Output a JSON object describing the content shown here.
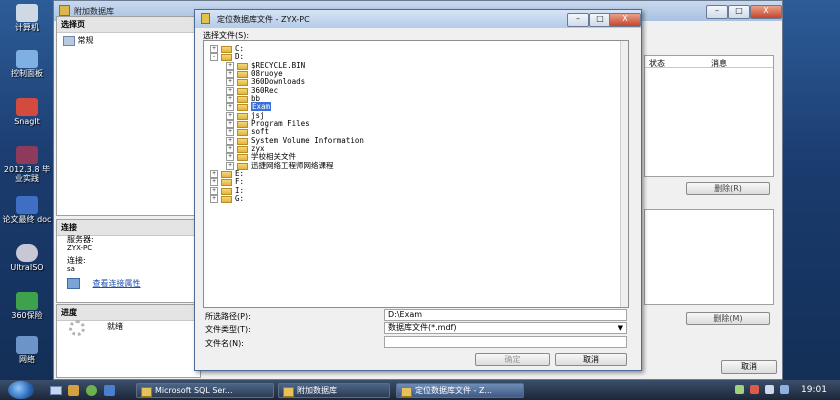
{
  "desktop": {
    "icons": [
      {
        "label": "计算机",
        "icon": "computer-icon"
      },
      {
        "label": "控制面板",
        "icon": "control-panel-icon"
      },
      {
        "label": "SnagIt",
        "icon": "snagit-icon"
      },
      {
        "label": "2012.3.8 毕业实践",
        "icon": "document-icon"
      },
      {
        "label": "论文最终 doc",
        "icon": "word-doc-icon"
      },
      {
        "label": "UltraISO",
        "icon": "ultraiso-icon"
      },
      {
        "label": "360保险",
        "icon": "360-safe-icon"
      },
      {
        "label": "网络",
        "icon": "network-icon"
      }
    ]
  },
  "attach_window": {
    "title": "附加数据库",
    "select_page_header": "选择页",
    "pages": [
      {
        "label": "常规",
        "icon": "page-icon"
      }
    ],
    "connection_header": "连接",
    "server_label": "服务器:",
    "server_value": "ZYX-PC",
    "connection_label": "连接:",
    "connection_value": "sa",
    "view_connection_link": "查看连接属性",
    "progress_header": "进度",
    "progress_status": "就绪",
    "grid_columns": [
      "状态",
      "消息"
    ],
    "remove_button_1": "删除(R)",
    "remove_button_2": "删除(M)",
    "cancel_button": "取消",
    "title_buttons": {
      "min": "–",
      "max": "□",
      "close": "X"
    }
  },
  "locate_dialog": {
    "title": "定位数据库文件 - ZYX-PC",
    "select_file_label": "选择文件(S):",
    "tree": [
      {
        "label": "C:",
        "level": 0,
        "expander": "+"
      },
      {
        "label": "D:",
        "level": 0,
        "expander": "-"
      },
      {
        "label": "$RECYCLE.BIN",
        "level": 1,
        "expander": "+"
      },
      {
        "label": "08ruoye",
        "level": 1,
        "expander": "+"
      },
      {
        "label": "360Downloads",
        "level": 1,
        "expander": "+"
      },
      {
        "label": "360Rec",
        "level": 1,
        "expander": "+"
      },
      {
        "label": "bb",
        "level": 1,
        "expander": "+"
      },
      {
        "label": "Exam",
        "level": 1,
        "expander": "+",
        "selected": true
      },
      {
        "label": "jsj",
        "level": 1,
        "expander": "+"
      },
      {
        "label": "Program Files",
        "level": 1,
        "expander": "+"
      },
      {
        "label": "soft",
        "level": 1,
        "expander": "+"
      },
      {
        "label": "System Volume Information",
        "level": 1,
        "expander": "+"
      },
      {
        "label": "zyx",
        "level": 1,
        "expander": "+"
      },
      {
        "label": "学校相关文件",
        "level": 1,
        "expander": "+"
      },
      {
        "label": "迅捷网络工程师网络课程",
        "level": 1,
        "expander": "+"
      },
      {
        "label": "E:",
        "level": 0,
        "expander": "+"
      },
      {
        "label": "F:",
        "level": 0,
        "expander": "+"
      },
      {
        "label": "I:",
        "level": 0,
        "expander": "+"
      },
      {
        "label": "G:",
        "level": 0,
        "expander": "+"
      }
    ],
    "selected_path_label": "所选路径(P):",
    "selected_path_value": "D:\\Exam",
    "file_type_label": "文件类型(T):",
    "file_type_value": "数据库文件(*.mdf)",
    "file_name_label": "文件名(N):",
    "file_name_value": "",
    "ok_button": "确定",
    "cancel_button": "取消",
    "title_buttons": {
      "min": "–",
      "max": "□",
      "close": "X"
    }
  },
  "taskbar": {
    "items": [
      {
        "label": "Microsoft SQL Ser...",
        "active": false
      },
      {
        "label": "附加数据库",
        "active": false
      },
      {
        "label": "定位数据库文件 - Z...",
        "active": true
      }
    ],
    "clock": "19:01"
  }
}
